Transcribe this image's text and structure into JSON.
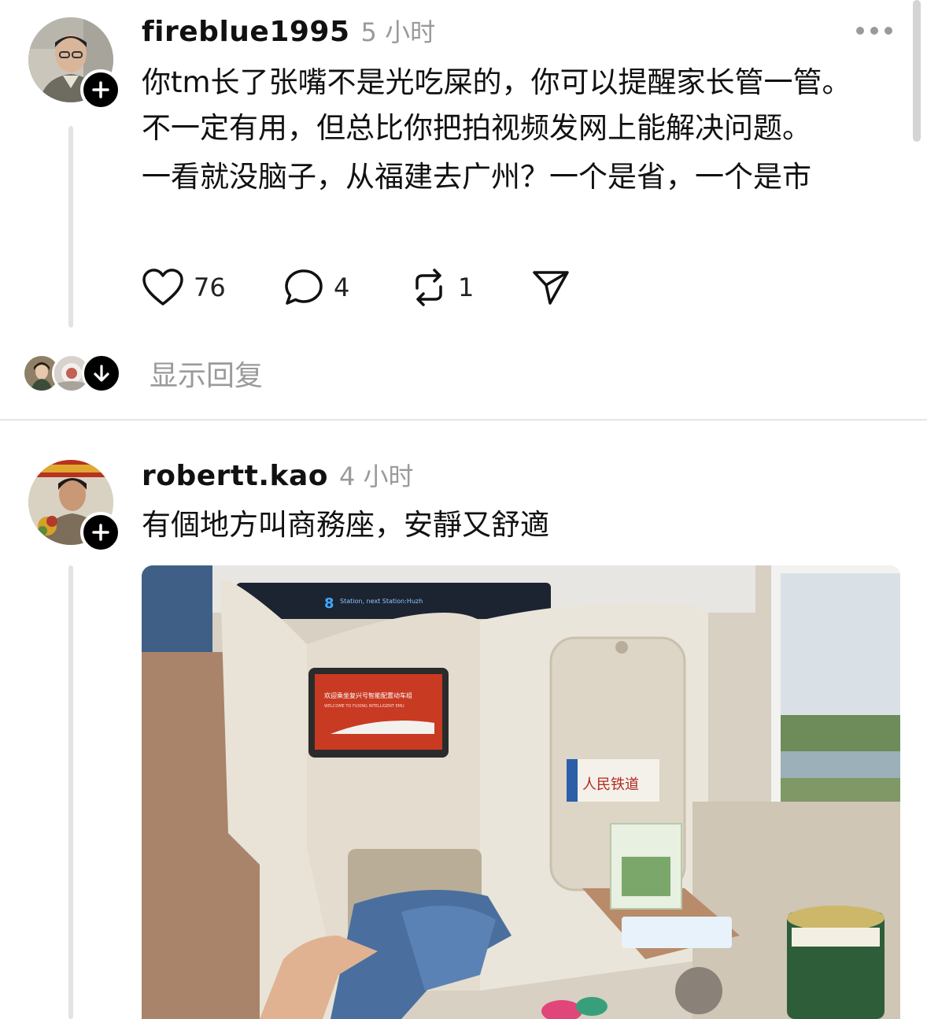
{
  "posts": [
    {
      "username": "fireblue1995",
      "time": "5 小时",
      "paragraphs": [
        "你tm长了张嘴不是光吃屎的，你可以提醒家长管一管。不一定有用，但总比你把拍视频发网上能解决问题。",
        "一看就没脑子，从福建去广州？一个是省，一个是市"
      ],
      "likes": "76",
      "comments": "4",
      "reposts": "1",
      "show_replies": "显示回复"
    },
    {
      "username": "robertt.kao",
      "time": "4 小时",
      "paragraphs": [
        "有個地方叫商務座，安靜又舒適"
      ],
      "media": {
        "screen_title": "欢迎乘坐复兴号智能配置动车组",
        "screen_subtitle": "WELCOME TO FUXING INTELLIGENT EMU",
        "led_number": "8",
        "led_text": "Station, next Station:Huzh",
        "magazine_title": "人民铁道"
      }
    }
  ],
  "colors": {
    "text": "#111111",
    "muted": "#9a9a9a",
    "thread_line": "#e3e3e3",
    "follow_button": "#000000"
  },
  "icons": [
    "plus-icon",
    "more-icon",
    "heart-icon",
    "comment-icon",
    "repost-icon",
    "share-icon",
    "arrow-down-icon"
  ]
}
